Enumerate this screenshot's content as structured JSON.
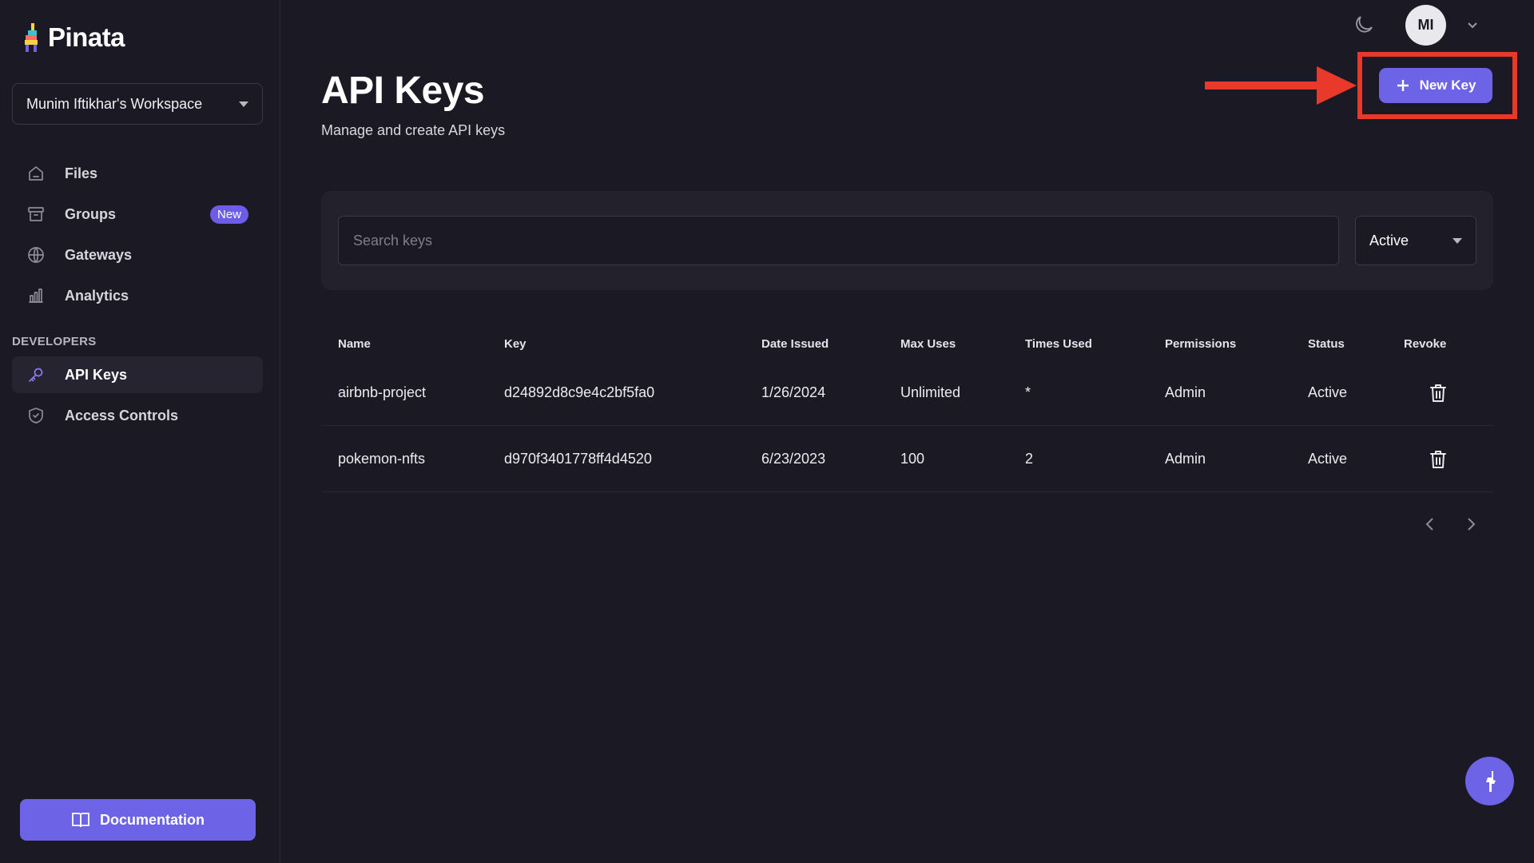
{
  "app": {
    "brand": "Pinata"
  },
  "sidebar": {
    "workspace": "Munim Iftikhar's Workspace",
    "items": [
      {
        "label": "Files",
        "icon": "home-icon"
      },
      {
        "label": "Groups",
        "icon": "archive-icon",
        "badge": "New"
      },
      {
        "label": "Gateways",
        "icon": "globe-icon"
      },
      {
        "label": "Analytics",
        "icon": "bar-chart-icon"
      }
    ],
    "section_label": "DEVELOPERS",
    "dev_items": [
      {
        "label": "API Keys",
        "icon": "key-icon",
        "active": true
      },
      {
        "label": "Access Controls",
        "icon": "shield-icon"
      }
    ],
    "docs_label": "Documentation"
  },
  "topbar": {
    "avatar_initials": "MI"
  },
  "header": {
    "title": "API Keys",
    "subtitle": "Manage and create API keys",
    "new_key_label": "New Key"
  },
  "search": {
    "placeholder": "Search keys",
    "value": "",
    "status_filter": "Active"
  },
  "table": {
    "columns": [
      "Name",
      "Key",
      "Date Issued",
      "Max Uses",
      "Times Used",
      "Permissions",
      "Status",
      "Revoke"
    ],
    "rows": [
      {
        "name": "airbnb-project",
        "key": "d24892d8c9e4c2bf5fa0",
        "date": "1/26/2024",
        "max_uses": "Unlimited",
        "times_used": "*",
        "permissions": "Admin",
        "status": "Active"
      },
      {
        "name": "pokemon-nfts",
        "key": "d970f3401778ff4d4520",
        "date": "6/23/2023",
        "max_uses": "100",
        "times_used": "2",
        "permissions": "Admin",
        "status": "Active"
      }
    ]
  },
  "colors": {
    "accent": "#6c63e6",
    "background": "#1b1923",
    "card": "#23212c",
    "highlight": "#e8392b"
  }
}
